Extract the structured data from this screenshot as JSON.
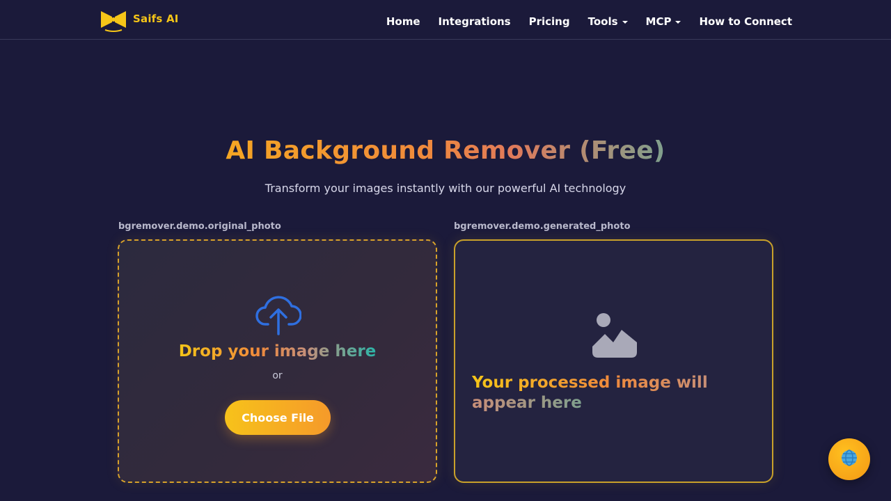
{
  "nav": {
    "brand_name": "Saifs AI",
    "links": [
      {
        "label": "Home"
      },
      {
        "label": "Integrations"
      },
      {
        "label": "Pricing"
      },
      {
        "label": "Tools",
        "dropdown": true
      },
      {
        "label": "MCP",
        "dropdown": true
      },
      {
        "label": "How to Connect"
      }
    ]
  },
  "hero": {
    "title": "AI Background Remover (Free)",
    "subtitle": "Transform your images instantly with our powerful AI technology"
  },
  "original_panel": {
    "label": "bgremover.demo.original_photo",
    "drop_text": "Drop your image here",
    "or_text": "or",
    "button_label": "Choose File",
    "icon": "cloud-upload-icon"
  },
  "generated_panel": {
    "label": "bgremover.demo.generated_photo",
    "placeholder_text": "Your processed image will appear here",
    "icon": "image-placeholder-icon"
  },
  "floating": {
    "icon": "globe-icon"
  },
  "colors": {
    "background": "#1b1a3a",
    "accent": "#f5a623",
    "brand": "#f5c518",
    "upload_icon": "#2f6fe0"
  }
}
